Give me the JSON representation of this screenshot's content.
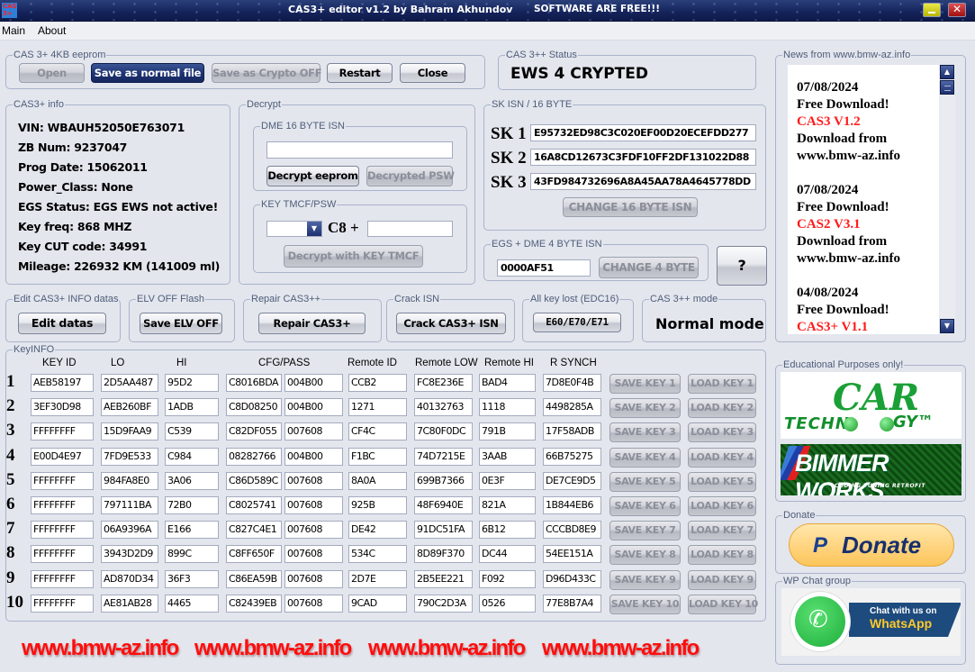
{
  "window": {
    "icon_text": "CAS 3+",
    "title": "CAS3+ editor v1.2 by Bahram Akhundov",
    "subtitle": "SOFTWARE ARE FREE!!!",
    "close_glyph": "✕"
  },
  "menu": {
    "items": [
      "Main",
      "About"
    ]
  },
  "eeprom": {
    "legend": "CAS 3+ 4KB eeprom",
    "open": "Open",
    "save_normal": "Save as normal file",
    "save_crypto_off": "Save as Crypto OFF",
    "restart": "Restart",
    "close": "Close"
  },
  "status": {
    "legend": "CAS 3++ Status",
    "value": "EWS 4 CRYPTED"
  },
  "info": {
    "legend": "CAS3+ info",
    "lines": [
      "VIN:  WBAUH52050E763071",
      "ZB Num:  9237047",
      "Prog Date:  15062011",
      "Power_Class:  None",
      "EGS Status:   EGS EWS not active!",
      "Key freq:  868 MHZ",
      "Key CUT code:  34991",
      "Mileage:  226932 KM (141009 ml)"
    ]
  },
  "decrypt": {
    "legend": "Decrypt",
    "dme_legend": "DME 16 BYTE ISN",
    "dme_value": "",
    "decrypt_eeprom": "Decrypt eeprom",
    "decrypted_psw": "Decrypted PSW",
    "tmcf_legend": "KEY TMCF/PSW",
    "dropdown_value": "",
    "dropdown_arrow": "▼",
    "c8_label": "C8 +",
    "tmcf_value": "",
    "decrypt_tmcf": "Decrypt with KEY TMCF"
  },
  "sk_isn": {
    "legend": "SK ISN / 16 BYTE",
    "items": [
      {
        "label": "SK 1",
        "value": "E95732ED98C3C020EF00D20ECEFDD277"
      },
      {
        "label": "SK 2",
        "value": "16A8CD12673C3FDF10FF2DF131022D88"
      },
      {
        "label": "SK 3",
        "value": "43FD984732696A8A45AA78A4645778DD"
      }
    ],
    "change_button": "CHANGE 16 BYTE ISN"
  },
  "egs_dme": {
    "legend": "EGS + DME 4 BYTE ISN",
    "value": "0000AF51",
    "change_button": "CHANGE 4 BYTE",
    "help_button": "?"
  },
  "news": {
    "legend": "News from www.bmw-az.info",
    "items": [
      {
        "date": "07/08/2024",
        "line1": "Free Download!",
        "product": "CAS3 V1.2",
        "line2": "Download from",
        "line3": "www.bmw-az.info"
      },
      {
        "date": "07/08/2024",
        "line1": "Free Download!",
        "product": "CAS2 V3.1",
        "line2": "Download from",
        "line3": "www.bmw-az.info"
      },
      {
        "date": "04/08/2024",
        "line1": "Free Download!",
        "product": "CAS3+ V1.1",
        "line2": "",
        "line3": ""
      }
    ],
    "scroll_up": "▲",
    "scroll_down": "▼"
  },
  "tools": {
    "edit": {
      "legend": "Edit CAS3+ INFO datas",
      "button": "Edit datas"
    },
    "elv": {
      "legend": "ELV OFF Flash",
      "button": "Save ELV OFF"
    },
    "repair": {
      "legend": "Repair CAS3++",
      "button": "Repair CAS3+"
    },
    "crack": {
      "legend": "Crack ISN",
      "button": "Crack CAS3+ ISN"
    },
    "akl": {
      "legend": "All key lost (EDC16)",
      "button": "E60/E70/E71"
    },
    "mode": {
      "legend": "CAS 3++ mode",
      "value": "Normal mode"
    }
  },
  "keyinfo": {
    "legend": "KeyINFO",
    "headers": [
      "KEY ID",
      "LO",
      "HI",
      "CFG/PASS",
      "Remote ID",
      "Remote LOW",
      "Remote HI",
      "R SYNCH"
    ],
    "rows": [
      {
        "num": "1",
        "cells": [
          "AEB58197",
          "2D5AA487",
          "95D2",
          "C8016BDA",
          "004B00",
          "CCB2",
          "FC8E236E",
          "BAD4",
          "7D8E0F4B"
        ],
        "save": "SAVE KEY 1",
        "load": "LOAD KEY 1"
      },
      {
        "num": "2",
        "cells": [
          "3EF30D98",
          "AEB260BF",
          "1ADB",
          "C8D08250",
          "004B00",
          "1271",
          "40132763",
          "1118",
          "4498285A"
        ],
        "save": "SAVE KEY 2",
        "load": "LOAD KEY 2"
      },
      {
        "num": "3",
        "cells": [
          "FFFFFFFF",
          "15D9FAA9",
          "C539",
          "C82DF055",
          "007608",
          "CF4C",
          "7C80F0DC",
          "791B",
          "17F58ADB"
        ],
        "save": "SAVE KEY 3",
        "load": "LOAD KEY 3"
      },
      {
        "num": "4",
        "cells": [
          "E00D4E97",
          "7FD9E533",
          "C984",
          "08282766",
          "004B00",
          "F1BC",
          "74D7215E",
          "3AAB",
          "66B75275"
        ],
        "save": "SAVE KEY 4",
        "load": "LOAD KEY 4"
      },
      {
        "num": "5",
        "cells": [
          "FFFFFFFF",
          "984FA8E0",
          "3A06",
          "C86D589C",
          "007608",
          "8A0A",
          "699B7366",
          "0E3F",
          "DE7CE9D5"
        ],
        "save": "SAVE KEY 5",
        "load": "LOAD KEY 5"
      },
      {
        "num": "6",
        "cells": [
          "FFFFFFFF",
          "797111BA",
          "72B0",
          "C8025741",
          "007608",
          "925B",
          "48F6940E",
          "821A",
          "1B844EB6"
        ],
        "save": "SAVE KEY 6",
        "load": "LOAD KEY 6"
      },
      {
        "num": "7",
        "cells": [
          "FFFFFFFF",
          "06A9396A",
          "E166",
          "C827C4E1",
          "007608",
          "DE42",
          "91DC51FA",
          "6B12",
          "CCCBD8E9"
        ],
        "save": "SAVE KEY 7",
        "load": "LOAD KEY 7"
      },
      {
        "num": "8",
        "cells": [
          "FFFFFFFF",
          "3943D2D9",
          "899C",
          "C8FF650F",
          "007608",
          "534C",
          "8D89F370",
          "DC44",
          "54EE151A"
        ],
        "save": "SAVE KEY 8",
        "load": "LOAD KEY 8"
      },
      {
        "num": "9",
        "cells": [
          "FFFFFFFF",
          "AD870D34",
          "36F3",
          "C86EA59B",
          "007608",
          "2D7E",
          "2B5EE221",
          "F092",
          "D96D433C"
        ],
        "save": "SAVE KEY 9",
        "load": "LOAD KEY 9"
      },
      {
        "num": "10",
        "cells": [
          "FFFFFFFF",
          "AE81AB28",
          "4465",
          "C82439EB",
          "007608",
          "9CAD",
          "790C2D3A",
          "0526",
          "77E8B7A4"
        ],
        "save": "SAVE KEY 10",
        "load": "LOAD KEY 10"
      }
    ]
  },
  "sidebar": {
    "edu_legend": "Educational Purposes only!",
    "cartech_left": "TECHN",
    "cartech_car": "CAR",
    "cartech_right": "GY™",
    "bimmer_title": "BIMMER WORKS",
    "bimmer_sub": "CODING TUNING RETROFIT",
    "donate_legend": "Donate",
    "donate_pp": "P",
    "donate_label": "Donate",
    "wp_legend": "WP Chat group",
    "wp_phone": "✆",
    "wp_line1": "Chat with us on",
    "wp_line2": "WhatsApp"
  },
  "footer": {
    "links": [
      "www.bmw-az.info",
      "www.bmw-az.info",
      "www.bmw-az.info",
      "www.bmw-az.info"
    ]
  },
  "colors": {
    "accent_red": "#ff1a1a",
    "titlebar": "#14235a",
    "panel": "#e3e6ed"
  }
}
